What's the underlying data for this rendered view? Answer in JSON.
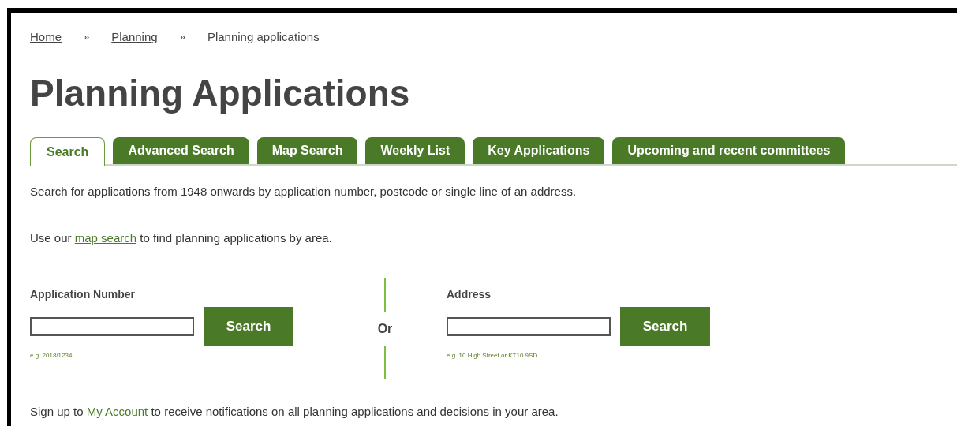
{
  "breadcrumb": [
    {
      "label": "Home",
      "kind": "link"
    },
    {
      "label": "»",
      "kind": "separator"
    },
    {
      "label": "Planning",
      "kind": "link"
    },
    {
      "label": "»",
      "kind": "separator"
    },
    {
      "label": "Planning applications",
      "kind": "current"
    }
  ],
  "title": "Planning Applications",
  "tabs": [
    {
      "label": "Search",
      "selected": true
    },
    {
      "label": "Advanced Search",
      "selected": false
    },
    {
      "label": "Map Search",
      "selected": false
    },
    {
      "label": "Weekly List",
      "selected": false
    },
    {
      "label": "Key Applications",
      "selected": false
    },
    {
      "label": "Upcoming and recent committees",
      "selected": false
    }
  ],
  "intro": "Search for applications from 1948 onwards by application number, postcode or single line of an address.",
  "map_note": {
    "before": "Use our",
    "link": "map search",
    "after": "to find planning applications by area."
  },
  "forms": [
    {
      "label": "Application Number",
      "button": "Search",
      "hint": "e.g. 2018/1234"
    },
    {
      "label": "Address",
      "button": "Search",
      "hint": "e.g. 10 High Street or KT10 9SD"
    }
  ],
  "separator": "Or",
  "signup": {
    "before": "Sign up to",
    "link": "My Account",
    "after": "to receive notifications on all planning applications and decisions in your area."
  }
}
